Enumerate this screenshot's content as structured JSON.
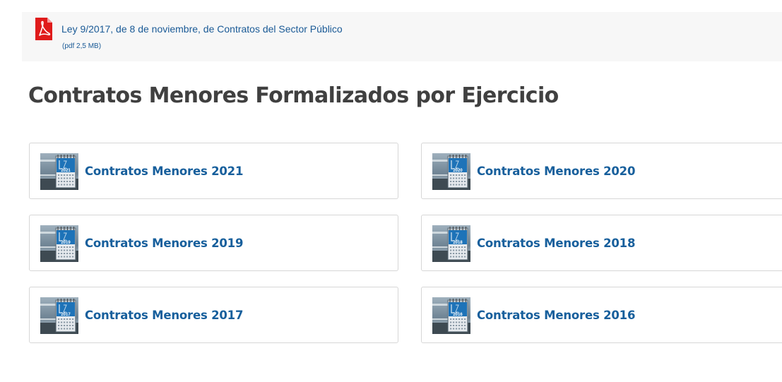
{
  "document": {
    "title": "Ley 9/2017, de 8 de noviembre, de Contratos del Sector Público",
    "meta": "(pdf 2,5 MB)",
    "icon": "pdf-icon"
  },
  "section": {
    "title": "Contratos Menores Formalizados por Ejercicio"
  },
  "cards": [
    {
      "label": "Contratos Menores 2021",
      "year": "2021",
      "icon": "calendar-thumbnail"
    },
    {
      "label": "Contratos Menores 2020",
      "year": "2020",
      "icon": "calendar-thumbnail"
    },
    {
      "label": "Contratos Menores 2019",
      "year": "2019",
      "icon": "calendar-thumbnail"
    },
    {
      "label": "Contratos Menores 2018",
      "year": "2018",
      "icon": "calendar-thumbnail"
    },
    {
      "label": "Contratos Menores 2017",
      "year": "2017",
      "icon": "calendar-thumbnail"
    },
    {
      "label": "Contratos Menores 2016",
      "year": "2016",
      "icon": "calendar-thumbnail"
    }
  ],
  "colors": {
    "link": "#175f9c",
    "heading": "#404040",
    "pdf_red": "#e01b1b",
    "doc_bar_bg": "#f7f7f7",
    "calendar_blue": "#1e73b8"
  }
}
